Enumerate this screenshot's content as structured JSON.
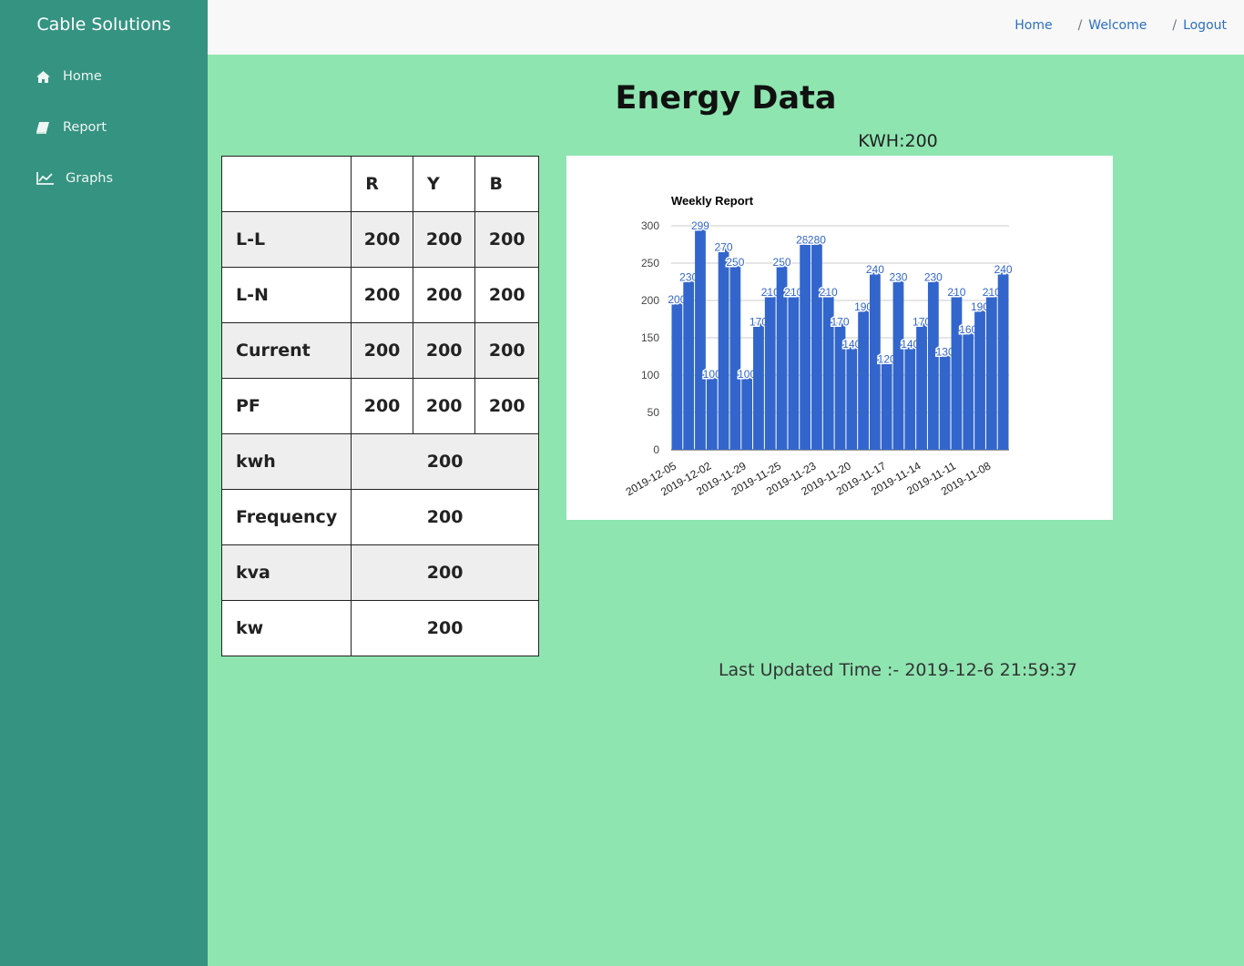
{
  "sidebar": {
    "brand": "Cable Solutions",
    "items": [
      {
        "label": "Home",
        "icon": "home-icon"
      },
      {
        "label": "Report",
        "icon": "book-icon"
      },
      {
        "label": "Graphs",
        "icon": "line-chart-icon"
      }
    ]
  },
  "breadcrumb": {
    "home": "Home",
    "welcome": "Welcome",
    "logout": "Logout",
    "separator": "/"
  },
  "page": {
    "title": "Energy Data",
    "kwh_label": "KWH:200",
    "last_updated": "Last Updated Time :- 2019-12-6 21:59:37"
  },
  "table": {
    "header": [
      "",
      "R",
      "Y",
      "B"
    ],
    "phase_rows": [
      {
        "label": "L-L",
        "values": [
          "200",
          "200",
          "200"
        ]
      },
      {
        "label": "L-N",
        "values": [
          "200",
          "200",
          "200"
        ]
      },
      {
        "label": "Current",
        "values": [
          "200",
          "200",
          "200"
        ]
      },
      {
        "label": "PF",
        "values": [
          "200",
          "200",
          "200"
        ]
      }
    ],
    "single_rows": [
      {
        "label": "kwh",
        "value": "200"
      },
      {
        "label": "Frequency",
        "value": "200"
      },
      {
        "label": "kva",
        "value": "200"
      },
      {
        "label": "kw",
        "value": "200"
      }
    ]
  },
  "colors": {
    "sidebar": "#359381",
    "page_background": "#8ee5b0",
    "bar": "#3366cc",
    "link": "#2a6fc2"
  },
  "chart_data": {
    "type": "bar",
    "title": "Weekly Report",
    "ylim": [
      0,
      300
    ],
    "yticks": [
      0,
      50,
      100,
      150,
      200,
      250,
      300
    ],
    "grid": true,
    "xtick_labels": [
      "2019-12-05",
      "2019-12-02",
      "2019-11-29",
      "2019-11-25",
      "2019-11-23",
      "2019-11-20",
      "2019-11-17",
      "2019-11-14",
      "2019-11-11",
      "2019-11-08"
    ],
    "values": [
      200,
      230,
      299,
      100,
      270,
      250,
      100,
      170,
      210,
      250,
      210,
      280,
      280,
      210,
      170,
      140,
      190,
      240,
      120,
      230,
      140,
      170,
      230,
      130,
      210,
      160,
      190,
      210,
      240
    ]
  }
}
